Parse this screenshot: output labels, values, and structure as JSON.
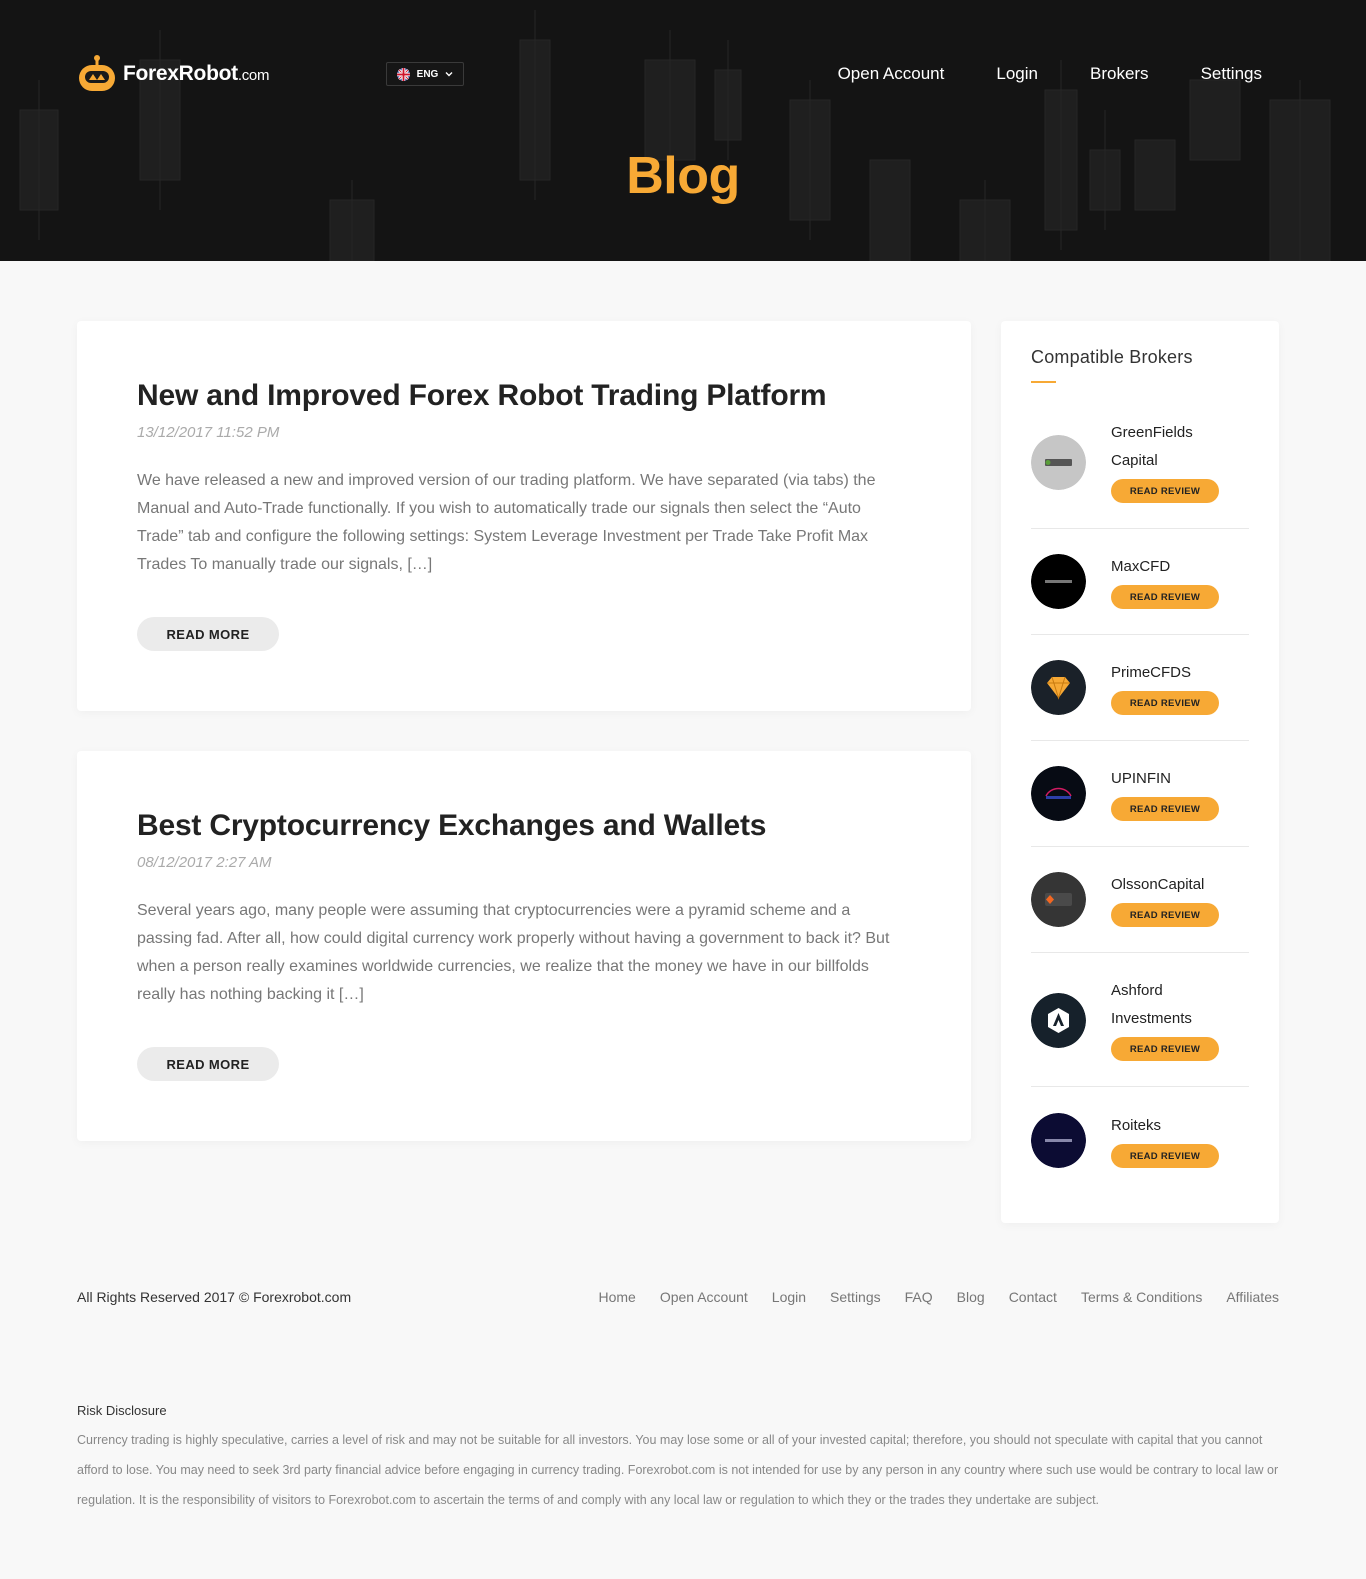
{
  "header": {
    "logo_name": "ForexRobot",
    "logo_suffix": ".com",
    "language": "ENG",
    "nav": [
      "Open Account",
      "Login",
      "Brokers",
      "Settings"
    ],
    "page_title": "Blog"
  },
  "posts": [
    {
      "title": "New and Improved Forex Robot Trading Platform",
      "date": "13/12/2017 11:52 PM",
      "excerpt": "We have released a new and improved version of our trading platform. We have separated (via tabs) the Manual and Auto-Trade functionally. If you wish to automatically trade our signals then select the “Auto Trade” tab and configure the following settings: System Leverage Investment per Trade Take Profit Max Trades To manually trade our signals, […]",
      "button": "READ MORE"
    },
    {
      "title": "Best Cryptocurrency Exchanges and Wallets",
      "date": "08/12/2017 2:27 AM",
      "excerpt": "Several years ago, many people were assuming that cryptocurrencies were a pyramid scheme and a passing fad. After all, how could digital currency work properly without having a government to back it? But when a person really examines worldwide currencies, we realize that the money we have in our billfolds really has nothing backing it […]",
      "button": "READ MORE"
    }
  ],
  "sidebar": {
    "title": "Compatible Brokers",
    "review_label": "READ REVIEW",
    "brokers": [
      {
        "name": "GreenFields Capital",
        "logo_color": "#c6c6c6",
        "logo_text": "GREEN"
      },
      {
        "name": "MaxCFD",
        "logo_color": "#000000",
        "logo_text": "MAXCFD"
      },
      {
        "name": "PrimeCFDS",
        "logo_color": "#1a2129",
        "logo_text": ""
      },
      {
        "name": "UPINFIN",
        "logo_color": "#070b14",
        "logo_text": "UPINFIN"
      },
      {
        "name": "OlssonCapital",
        "logo_color": "#353535",
        "logo_text": "OLSSON"
      },
      {
        "name": "Ashford Investments",
        "logo_color": "#16212b",
        "logo_text": ""
      },
      {
        "name": "Roiteks",
        "logo_color": "#0c0c33",
        "logo_text": "ROITEKS"
      }
    ]
  },
  "footer": {
    "copyright": "All Rights Reserved 2017 © Forexrobot.com",
    "links": [
      "Home",
      "Open Account",
      "Login",
      "Settings",
      "FAQ",
      "Blog",
      "Contact",
      "Terms & Conditions",
      "Affiliates"
    ],
    "risk_title": "Risk Disclosure",
    "risk_text": "Currency trading is highly speculative, carries a level of risk and may not be suitable for all investors. You may lose some or all of your invested capital; therefore, you should not speculate with capital that you cannot afford to lose. You may need to seek 3rd party financial advice before engaging in currency trading. Forexrobot.com is not intended for use by any person in any country where such use would be contrary to local law or regulation. It is the responsibility of visitors to Forexrobot.com to ascertain the terms of and comply with any local law or regulation to which they or the trades they undertake are subject."
  },
  "colors": {
    "accent": "#f7a935",
    "header_bg": "#141414",
    "page_bg": "#f8f8f8"
  }
}
